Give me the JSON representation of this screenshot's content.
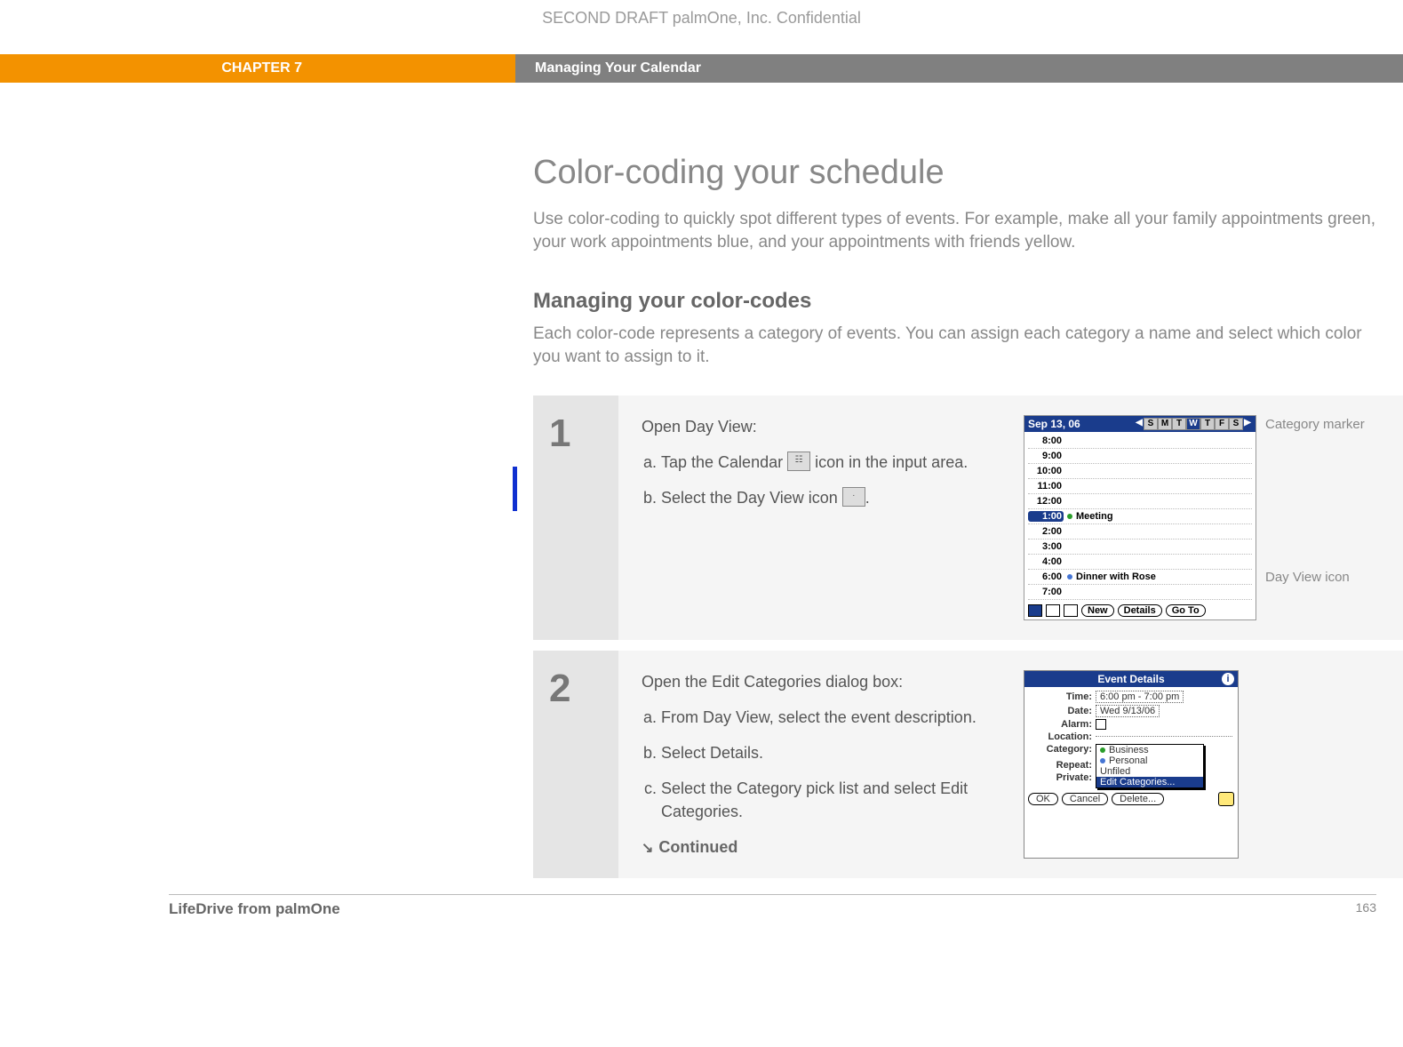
{
  "header_draft": "SECOND DRAFT palmOne, Inc.  Confidential",
  "chapter": {
    "label": "CHAPTER 7",
    "title": "Managing Your Calendar"
  },
  "page": {
    "heading": "Color-coding your schedule",
    "intro": "Use color-coding to quickly spot different types of events. For example, make all your family appointments green, your work appointments blue, and your appointments with friends yellow.",
    "subheading": "Managing your color-codes",
    "subtext": "Each color-code represents a category of events. You can assign each category a name and select which color you want to assign to it."
  },
  "steps": [
    {
      "num": "1",
      "title": "Open Day View:",
      "items": [
        "Tap the Calendar [icon] icon in the input area.",
        "Select the Day View icon [icon]."
      ]
    },
    {
      "num": "2",
      "title": "Open the Edit Categories dialog box:",
      "items": [
        "From Day View, select the event description.",
        "Select Details.",
        "Select the Category pick list and select Edit Categories."
      ],
      "continued": "Continued"
    }
  ],
  "palm": {
    "date": "Sep 13, 06",
    "days": [
      "S",
      "M",
      "T",
      "W",
      "T",
      "F",
      "S"
    ],
    "selectedDay": 3,
    "rows": [
      {
        "t": "8:00"
      },
      {
        "t": "9:00"
      },
      {
        "t": "10:00"
      },
      {
        "t": "11:00"
      },
      {
        "t": "12:00"
      },
      {
        "t": "1:00",
        "sel": true,
        "dot": "green",
        "ev": "Meeting"
      },
      {
        "t": "2:00"
      },
      {
        "t": "3:00"
      },
      {
        "t": "4:00"
      },
      {
        "t": "6:00",
        "dot": "blue",
        "ev": "Dinner with Rose"
      },
      {
        "t": "7:00"
      }
    ],
    "buttons": {
      "new": "New",
      "details": "Details",
      "goto": "Go To"
    },
    "callouts": {
      "category": "Category marker",
      "dayview": "Day View icon"
    }
  },
  "dlg": {
    "title": "Event Details",
    "time_label": "Time:",
    "time": "6:00 pm - 7:00 pm",
    "date_label": "Date:",
    "date": "Wed 9/13/06",
    "alarm_label": "Alarm:",
    "location_label": "Location:",
    "category_label": "Category:",
    "repeat_label": "Repeat:",
    "private_label": "Private:",
    "cats": [
      "Business",
      "Personal",
      "Unfiled",
      "Edit Categories..."
    ],
    "ok": "OK",
    "cancel": "Cancel",
    "delete": "Delete..."
  },
  "footer": {
    "brand": "LifeDrive from palmOne",
    "page": "163"
  }
}
